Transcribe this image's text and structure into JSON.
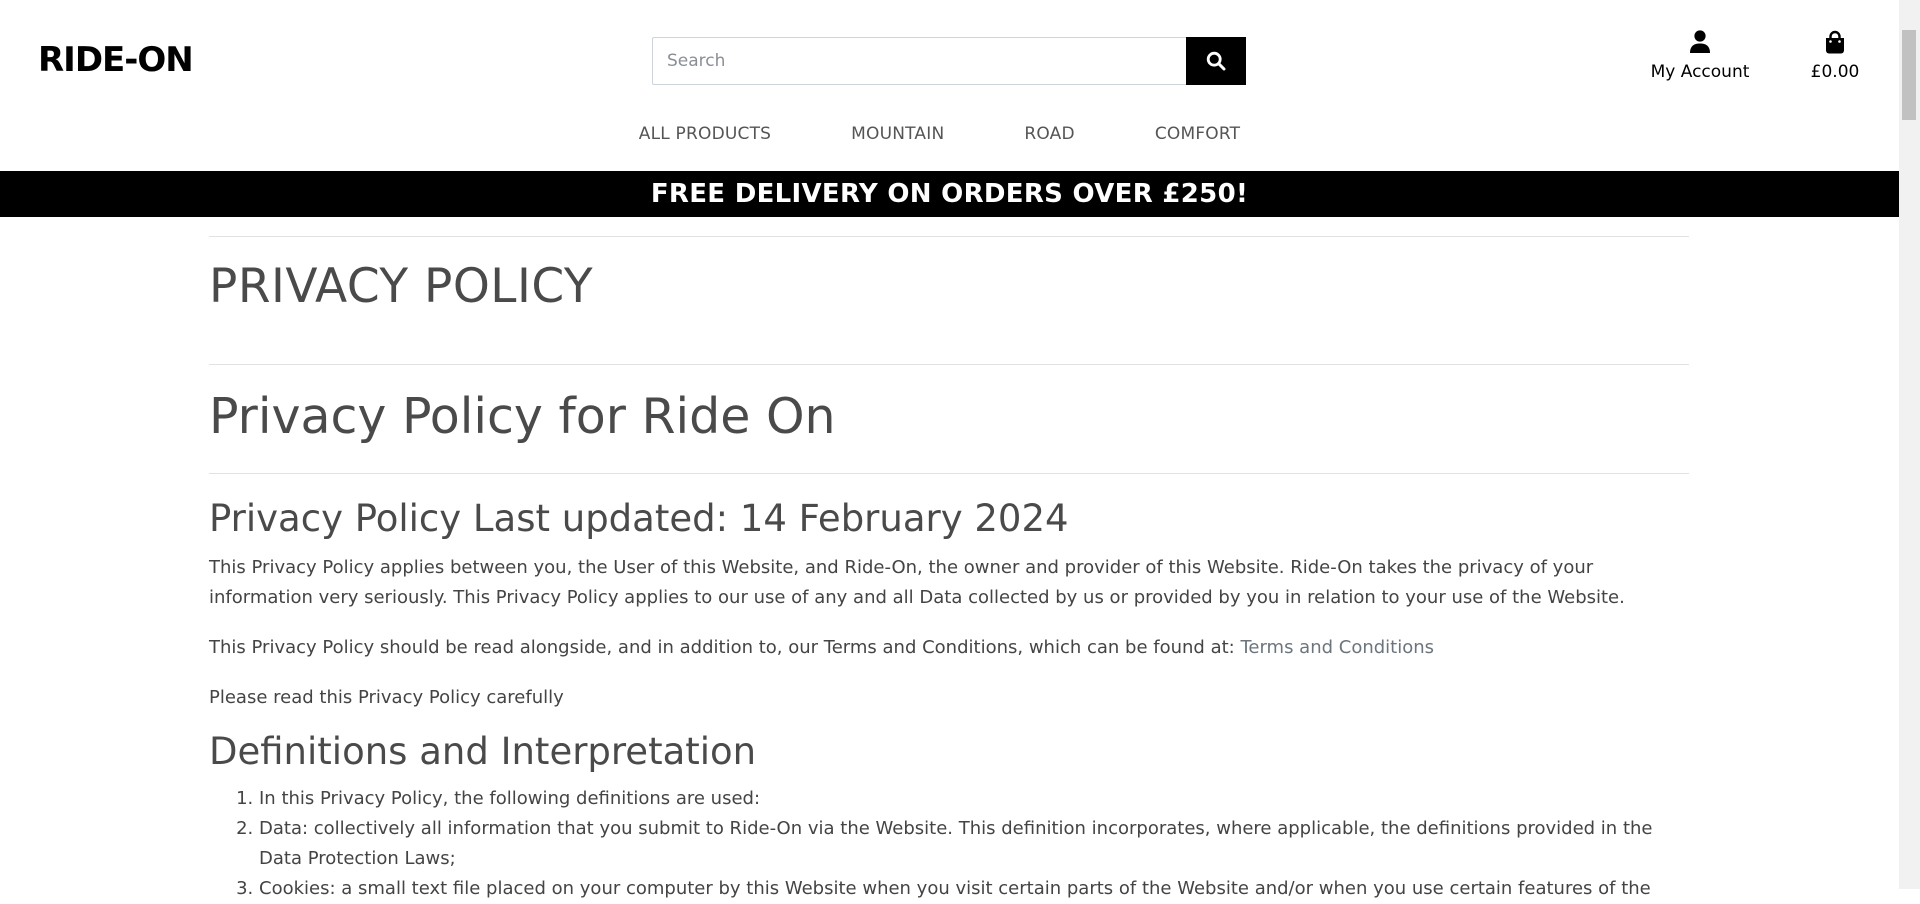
{
  "header": {
    "logo": "RIDE-ON",
    "search": {
      "placeholder": "Search",
      "value": ""
    },
    "account_label": "My Account",
    "cart_total": "£0.00"
  },
  "nav": {
    "items": [
      {
        "label": "ALL PRODUCTS"
      },
      {
        "label": "MOUNTAIN"
      },
      {
        "label": "ROAD"
      },
      {
        "label": "COMFORT"
      }
    ]
  },
  "banner": {
    "text": "FREE DELIVERY ON ORDERS OVER £250!"
  },
  "main": {
    "page_title": "PRIVACY POLICY",
    "doc_title": "Privacy Policy for Ride On",
    "updated_heading": "Privacy Policy Last updated: 14 February 2024",
    "para1": "This Privacy Policy applies between you, the User of this Website, and Ride-On, the owner and provider of this Website. Ride-On takes the privacy of your information very seriously. This Privacy Policy applies to our use of any and all Data collected by us or provided by you in relation to your use of the Website.",
    "para2_prefix": "This Privacy Policy should be read alongside, and in addition to, our Terms and Conditions, which can be found at: ",
    "para2_link": "Terms and Conditions",
    "para3": "Please read this Privacy Policy carefully",
    "definitions_heading": "Definitions and Interpretation",
    "definitions": [
      "In this Privacy Policy, the following definitions are used:",
      "Data: collectively all information that you submit to Ride-On via the Website. This definition incorporates, where applicable, the definitions provided in the Data Protection Laws;",
      "Cookies: a small text file placed on your computer by this Website when you visit certain parts of the Website and/or when you use certain features of the"
    ]
  }
}
